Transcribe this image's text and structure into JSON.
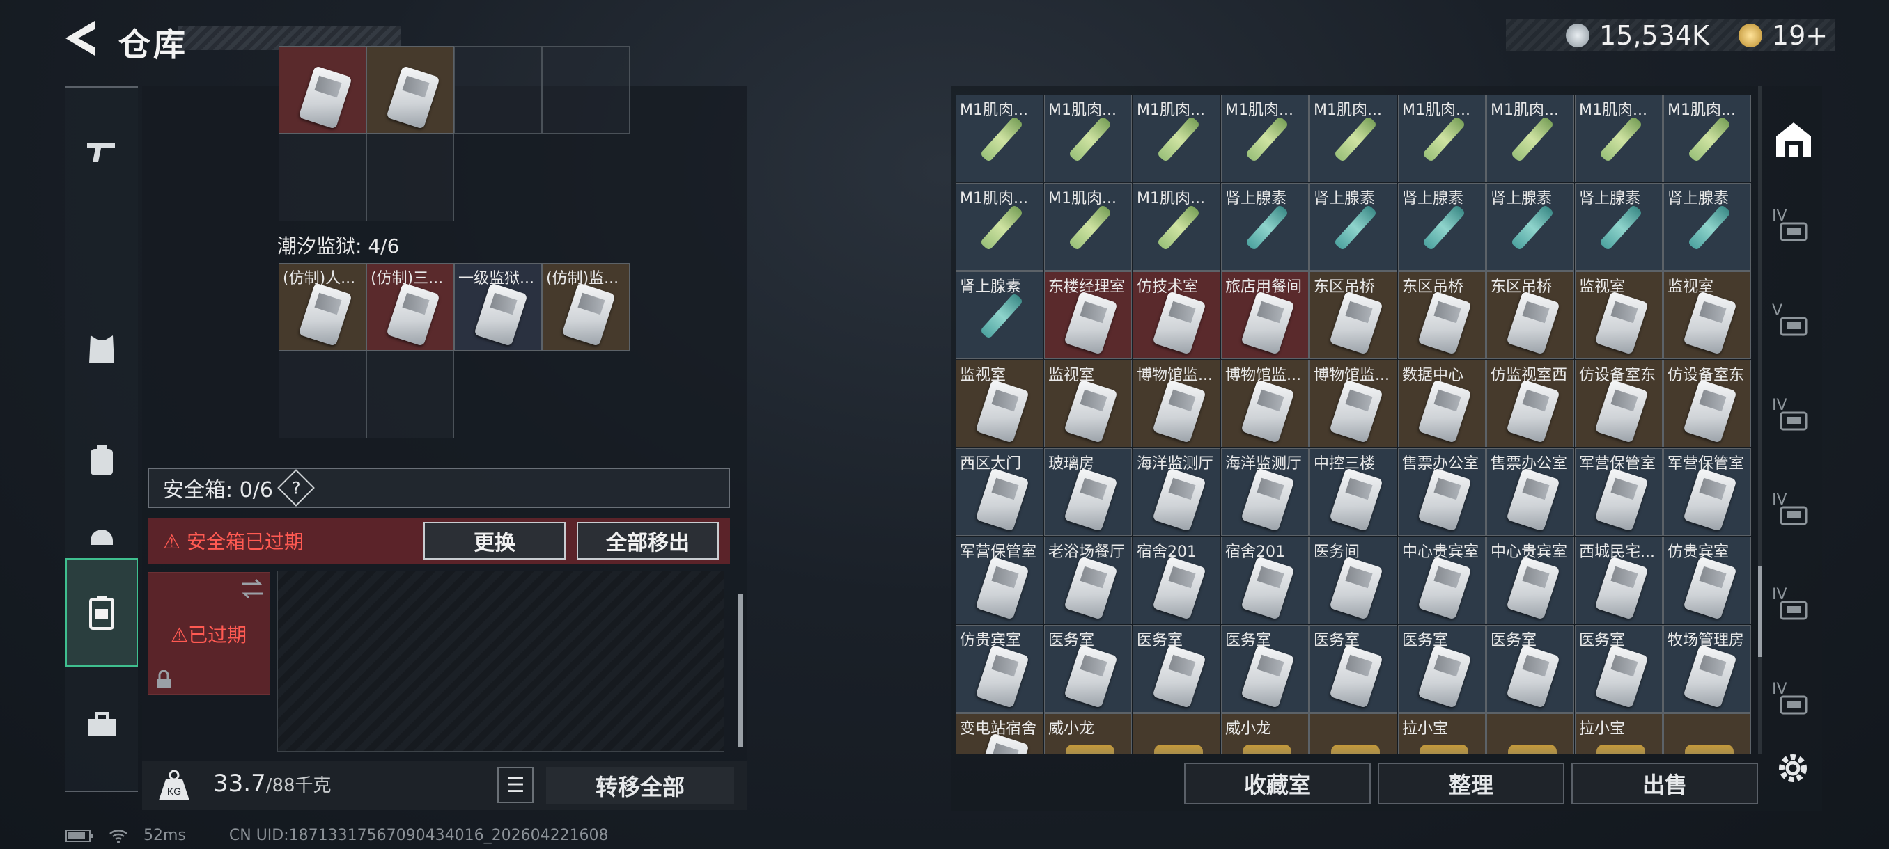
{
  "header": {
    "title": "仓库",
    "currency_silver": "15,534K",
    "currency_gold": "19+"
  },
  "left": {
    "prison_label": "潮汐监狱: 4/6",
    "prison_items": [
      {
        "label": "(仿制)人...",
        "bg": "brown"
      },
      {
        "label": "(仿制)三...",
        "bg": "red"
      },
      {
        "label": "一级监狱...",
        "bg": "navy"
      },
      {
        "label": "(仿制)监...",
        "bg": "brown"
      }
    ],
    "safe_box_label": "安全箱: 0/6",
    "safe_help": "?",
    "expired_text": "安全箱已过期",
    "replace_button": "更换",
    "move_all_button": "全部移出",
    "safe_slot_expired": "已过期",
    "weight_value": "33.7",
    "weight_max": "/88千克",
    "transfer_all_button": "转移全部"
  },
  "status": {
    "ping": "52ms",
    "uid": "CN UID:18713317567090434016_202604221608"
  },
  "right": {
    "grid": [
      {
        "label": "M1肌肉...",
        "type": "green",
        "bg": "blue"
      },
      {
        "label": "M1肌肉...",
        "type": "green",
        "bg": "blue"
      },
      {
        "label": "M1肌肉...",
        "type": "green",
        "bg": "blue"
      },
      {
        "label": "M1肌肉...",
        "type": "green",
        "bg": "blue"
      },
      {
        "label": "M1肌肉...",
        "type": "green",
        "bg": "blue"
      },
      {
        "label": "M1肌肉...",
        "type": "green",
        "bg": "blue"
      },
      {
        "label": "M1肌肉...",
        "type": "green",
        "bg": "blue"
      },
      {
        "label": "M1肌肉...",
        "type": "green",
        "bg": "blue"
      },
      {
        "label": "M1肌肉...",
        "type": "green",
        "bg": "blue"
      },
      {
        "label": "M1肌肉...",
        "type": "green",
        "bg": "blue"
      },
      {
        "label": "M1肌肉...",
        "type": "green",
        "bg": "blue"
      },
      {
        "label": "M1肌肉...",
        "type": "green",
        "bg": "blue"
      },
      {
        "label": "肾上腺素",
        "type": "teal",
        "bg": "blue"
      },
      {
        "label": "肾上腺素",
        "type": "teal",
        "bg": "blue"
      },
      {
        "label": "肾上腺素",
        "type": "teal",
        "bg": "blue"
      },
      {
        "label": "肾上腺素",
        "type": "teal",
        "bg": "blue"
      },
      {
        "label": "肾上腺素",
        "type": "teal",
        "bg": "blue"
      },
      {
        "label": "肾上腺素",
        "type": "teal",
        "bg": "blue"
      },
      {
        "label": "肾上腺素",
        "type": "teal",
        "bg": "blue"
      },
      {
        "label": "东楼经理室",
        "type": "card",
        "bg": "red"
      },
      {
        "label": "仿技术室",
        "type": "card",
        "bg": "red"
      },
      {
        "label": "旅店用餐间",
        "type": "card",
        "bg": "red"
      },
      {
        "label": "东区吊桥",
        "type": "card",
        "bg": "brown"
      },
      {
        "label": "东区吊桥",
        "type": "card",
        "bg": "brown"
      },
      {
        "label": "东区吊桥",
        "type": "card",
        "bg": "brown"
      },
      {
        "label": "监视室",
        "type": "card",
        "bg": "brown"
      },
      {
        "label": "监视室",
        "type": "card",
        "bg": "brown"
      },
      {
        "label": "监视室",
        "type": "card",
        "bg": "brown"
      },
      {
        "label": "监视室",
        "type": "card",
        "bg": "brown"
      },
      {
        "label": "博物馆监...",
        "type": "card",
        "bg": "brown"
      },
      {
        "label": "博物馆监...",
        "type": "card",
        "bg": "brown"
      },
      {
        "label": "博物馆监...",
        "type": "card",
        "bg": "brown"
      },
      {
        "label": "数据中心",
        "type": "card",
        "bg": "brown"
      },
      {
        "label": "仿监视室西",
        "type": "card",
        "bg": "brown"
      },
      {
        "label": "仿设备室东",
        "type": "card",
        "bg": "brown"
      },
      {
        "label": "仿设备室东",
        "type": "card",
        "bg": "brown"
      },
      {
        "label": "西区大门",
        "type": "card",
        "bg": "blue"
      },
      {
        "label": "玻璃房",
        "type": "card",
        "bg": "blue"
      },
      {
        "label": "海洋监测厅",
        "type": "card",
        "bg": "blue"
      },
      {
        "label": "海洋监测厅",
        "type": "card",
        "bg": "blue"
      },
      {
        "label": "中控三楼",
        "type": "card",
        "bg": "blue"
      },
      {
        "label": "售票办公室",
        "type": "card",
        "bg": "blue"
      },
      {
        "label": "售票办公室",
        "type": "card",
        "bg": "blue"
      },
      {
        "label": "军营保管室",
        "type": "card",
        "bg": "blue"
      },
      {
        "label": "军营保管室",
        "type": "card",
        "bg": "blue"
      },
      {
        "label": "军营保管室",
        "type": "card",
        "bg": "blue"
      },
      {
        "label": "老浴场餐厅",
        "type": "card",
        "bg": "blue"
      },
      {
        "label": "宿舍201",
        "type": "card",
        "bg": "blue"
      },
      {
        "label": "宿舍201",
        "type": "card",
        "bg": "blue"
      },
      {
        "label": "医务间",
        "type": "card",
        "bg": "blue"
      },
      {
        "label": "中心贵宾室",
        "type": "card",
        "bg": "blue"
      },
      {
        "label": "中心贵宾室",
        "type": "card",
        "bg": "blue"
      },
      {
        "label": "西城民宅...",
        "type": "card",
        "bg": "blue"
      },
      {
        "label": "仿贵宾室",
        "type": "card",
        "bg": "blue"
      },
      {
        "label": "仿贵宾室",
        "type": "card",
        "bg": "blue"
      },
      {
        "label": "医务室",
        "type": "card",
        "bg": "blue"
      },
      {
        "label": "医务室",
        "type": "card",
        "bg": "blue"
      },
      {
        "label": "医务室",
        "type": "card",
        "bg": "blue"
      },
      {
        "label": "医务室",
        "type": "card",
        "bg": "blue"
      },
      {
        "label": "医务室",
        "type": "card",
        "bg": "blue"
      },
      {
        "label": "医务室",
        "type": "card",
        "bg": "blue"
      },
      {
        "label": "医务室",
        "type": "card",
        "bg": "blue"
      },
      {
        "label": "牧场管理房",
        "type": "card",
        "bg": "blue"
      },
      {
        "label": "变电站宿舍",
        "type": "card",
        "bg": "brown"
      },
      {
        "label": "威小龙",
        "type": "none",
        "bg": "brown"
      },
      {
        "label": "",
        "type": "none",
        "bg": "brown"
      },
      {
        "label": "威小龙",
        "type": "none",
        "bg": "brown"
      },
      {
        "label": "",
        "type": "none",
        "bg": "brown"
      },
      {
        "label": "拉小宝",
        "type": "none",
        "bg": "brown"
      },
      {
        "label": "",
        "type": "none",
        "bg": "brown"
      },
      {
        "label": "拉小宝",
        "type": "none",
        "bg": "brown"
      },
      {
        "label": "",
        "type": "none",
        "bg": "brown"
      }
    ],
    "collection_button": "收藏室",
    "sort_button": "整理",
    "sell_button": "出售"
  },
  "right_icons": {
    "tier_labels": [
      "IV",
      "V",
      "IV",
      "IV",
      "IV",
      "IV"
    ]
  }
}
